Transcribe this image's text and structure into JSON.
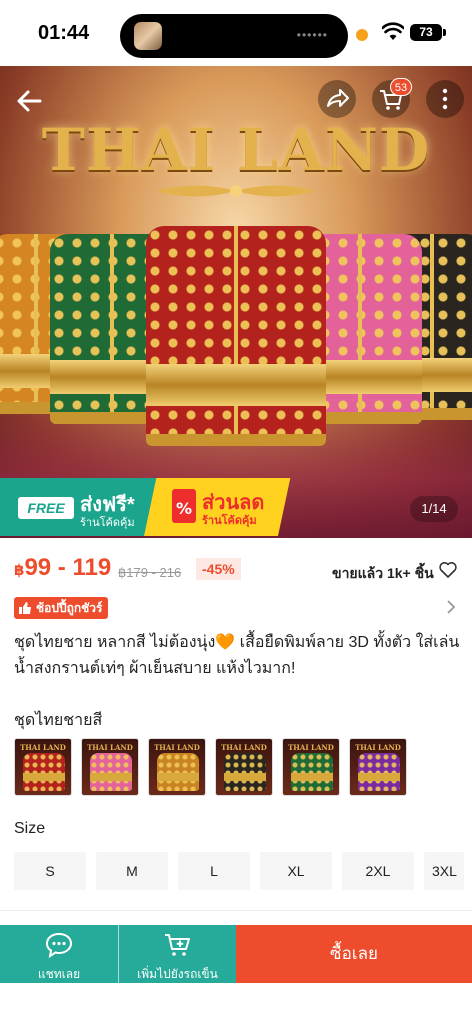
{
  "status_bar": {
    "time": "01:44",
    "battery": "73"
  },
  "hero": {
    "title": "THAI LAND",
    "cart_count": "53",
    "page_counter": "1/14",
    "promo_free": {
      "badge": "FREE",
      "title": "ส่งฟรี*",
      "subtitle": "ร้านโค้ดคุ้ม"
    },
    "promo_discount": {
      "title": "ส่วนลด",
      "subtitle": "ร้านโค้ดคุ้ม"
    }
  },
  "price": {
    "currency": "฿",
    "range": "99 - 119",
    "original": "฿179 - 216",
    "discount": "-45%",
    "sold": "ขายแล้ว 1k+ ชิ้น"
  },
  "guarantee": "ช้อปปี้ถูกชัวร์",
  "product_title": "ชุดไทยชาย หลากสี ไม่ต้องนุ่ง🧡 เสื้อยืดพิมพ์ลาย 3D ทั้งตัว ใส่เล่นน้ำสงกรานต์เท่ๆ ผ้าเย็นสบาย แห้งไวมาก!",
  "variants": {
    "label": "ชุดไทยชายสี",
    "logo": "THAI LAND",
    "items": [
      {
        "color": "#b3221c"
      },
      {
        "color": "#e3629a"
      },
      {
        "color": "#c98323"
      },
      {
        "color": "#2b2520"
      },
      {
        "color": "#1f6a35"
      },
      {
        "color": "#7b2aa0"
      }
    ]
  },
  "sizes": {
    "label": "Size",
    "items": [
      "S",
      "M",
      "L",
      "XL",
      "2XL",
      "3XL"
    ]
  },
  "bottom_bar": {
    "chat": "แชทเลย",
    "add_to_cart": "เพิ่มไปยังรถเข็น",
    "buy_now": "ซื้อเลย"
  },
  "colors": {
    "accent": "#ee4d2d",
    "teal": "#26aa99",
    "promo_green": "#1aa58c",
    "promo_yellow": "#ffd21f"
  }
}
